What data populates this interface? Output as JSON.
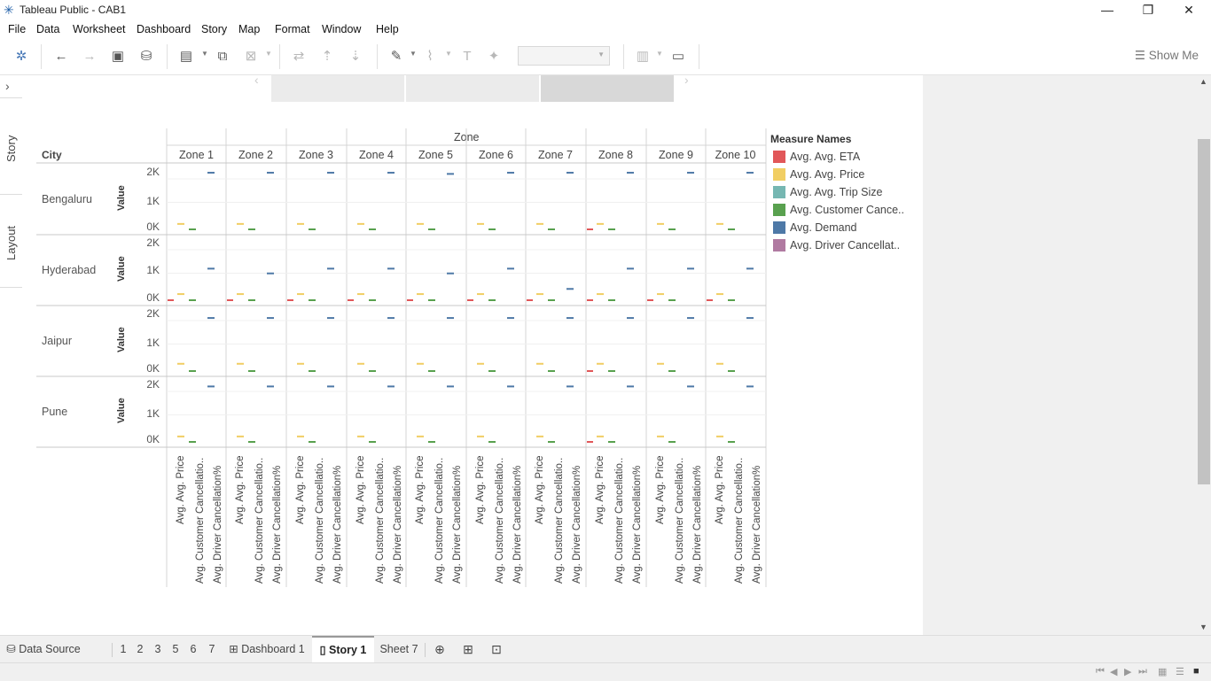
{
  "window": {
    "title": "Tableau Public - CAB1",
    "minimize": "—",
    "restore": "❐",
    "close": "✕"
  },
  "menu": [
    "File",
    "Data",
    "Worksheet",
    "Dashboard",
    "Story",
    "Map",
    "Format",
    "Window",
    "Help"
  ],
  "toolbar": {
    "show_me": "Show Me"
  },
  "left_rail": {
    "expand": "›",
    "story_tab": "Story",
    "layout_tab": "Layout"
  },
  "chart": {
    "zone_header": "Zone",
    "city_header": "City",
    "value_label": "Value",
    "zones": [
      "Zone 1",
      "Zone 2",
      "Zone 3",
      "Zone 4",
      "Zone 5",
      "Zone 6",
      "Zone 7",
      "Zone 8",
      "Zone 9",
      "Zone 10"
    ],
    "cities": [
      "Bengaluru",
      "Hyderabad",
      "Jaipur",
      "Pune"
    ],
    "ticks": [
      "2K",
      "1K",
      "0K"
    ],
    "x_labels": [
      "Avg. Avg. Price",
      "Avg. Customer Cancellatio..",
      "Avg. Driver Cancellation%"
    ]
  },
  "chart_data": {
    "type": "scatter",
    "title": "",
    "x_header": "Zone",
    "row_header": "City",
    "ylabel": "Value",
    "ylim": [
      0,
      2300
    ],
    "y_ticks": [
      "2K",
      "1K",
      "0K"
    ],
    "categories": [
      "Avg. Avg. Price",
      "Avg. Customer Cancellatio..",
      "Avg. Driver Cancellation%"
    ],
    "panes": [
      {
        "city": "Bengaluru",
        "zones": [
          "Zone 1",
          "Zone 2",
          "Zone 3",
          "Zone 4",
          "Zone 5",
          "Zone 6",
          "Zone 7",
          "Zone 8",
          "Zone 9",
          "Zone 10"
        ],
        "demand": [
          2150,
          2150,
          2150,
          2150,
          2100,
          2150,
          2150,
          2150,
          2150,
          2150
        ],
        "price": 120,
        "cust_cancel": 10,
        "driver_cancel": 10
      },
      {
        "city": "Hyderabad",
        "zones": [
          "Zone 1",
          "Zone 2",
          "Zone 3",
          "Zone 4",
          "Zone 5",
          "Zone 6",
          "Zone 7",
          "Zone 8",
          "Zone 9",
          "Zone 10"
        ],
        "demand": [
          1100,
          900,
          1100,
          1100,
          900,
          1100,
          250,
          1100,
          1100,
          1100
        ],
        "price": 150,
        "cust_cancel": 10,
        "driver_cancel": 10
      },
      {
        "city": "Jaipur",
        "zones": [
          "Zone 1",
          "Zone 2",
          "Zone 3",
          "Zone 4",
          "Zone 5",
          "Zone 6",
          "Zone 7",
          "Zone 8",
          "Zone 9",
          "Zone 10"
        ],
        "demand": [
          2000,
          2000,
          2000,
          2000,
          2000,
          2000,
          2000,
          2000,
          2000,
          2000
        ],
        "price": 200,
        "cust_cancel": 20,
        "driver_cancel": 10
      },
      {
        "city": "Pune",
        "zones": [
          "Zone 1",
          "Zone 2",
          "Zone 3",
          "Zone 4",
          "Zone 5",
          "Zone 6",
          "Zone 7",
          "Zone 8",
          "Zone 9",
          "Zone 10"
        ],
        "demand": [
          2100,
          2100,
          2100,
          2100,
          2100,
          2100,
          2100,
          2100,
          2100,
          2100
        ],
        "price": 120,
        "cust_cancel": 10,
        "driver_cancel": 10
      }
    ],
    "legend": {
      "title": "Measure Names",
      "placement": "right",
      "items": [
        {
          "name": "Avg. Avg. ETA",
          "color": "#e15759"
        },
        {
          "name": "Avg. Avg. Price",
          "color": "#f1ce63"
        },
        {
          "name": "Avg. Avg. Trip Size",
          "color": "#76b7b2"
        },
        {
          "name": "Avg. Customer Cance..",
          "color": "#59a14f"
        },
        {
          "name": "Avg. Demand",
          "color": "#4e79a7"
        },
        {
          "name": "Avg. Driver Cancellat..",
          "color": "#b07aa1"
        }
      ]
    }
  },
  "bottom_tabs": {
    "data_source": "Data Source",
    "sheets": [
      "1",
      "2",
      "3",
      "5",
      "6",
      "7"
    ],
    "dashboard": "Dashboard 1",
    "story": "Story 1",
    "sheet7": "Sheet 7"
  }
}
